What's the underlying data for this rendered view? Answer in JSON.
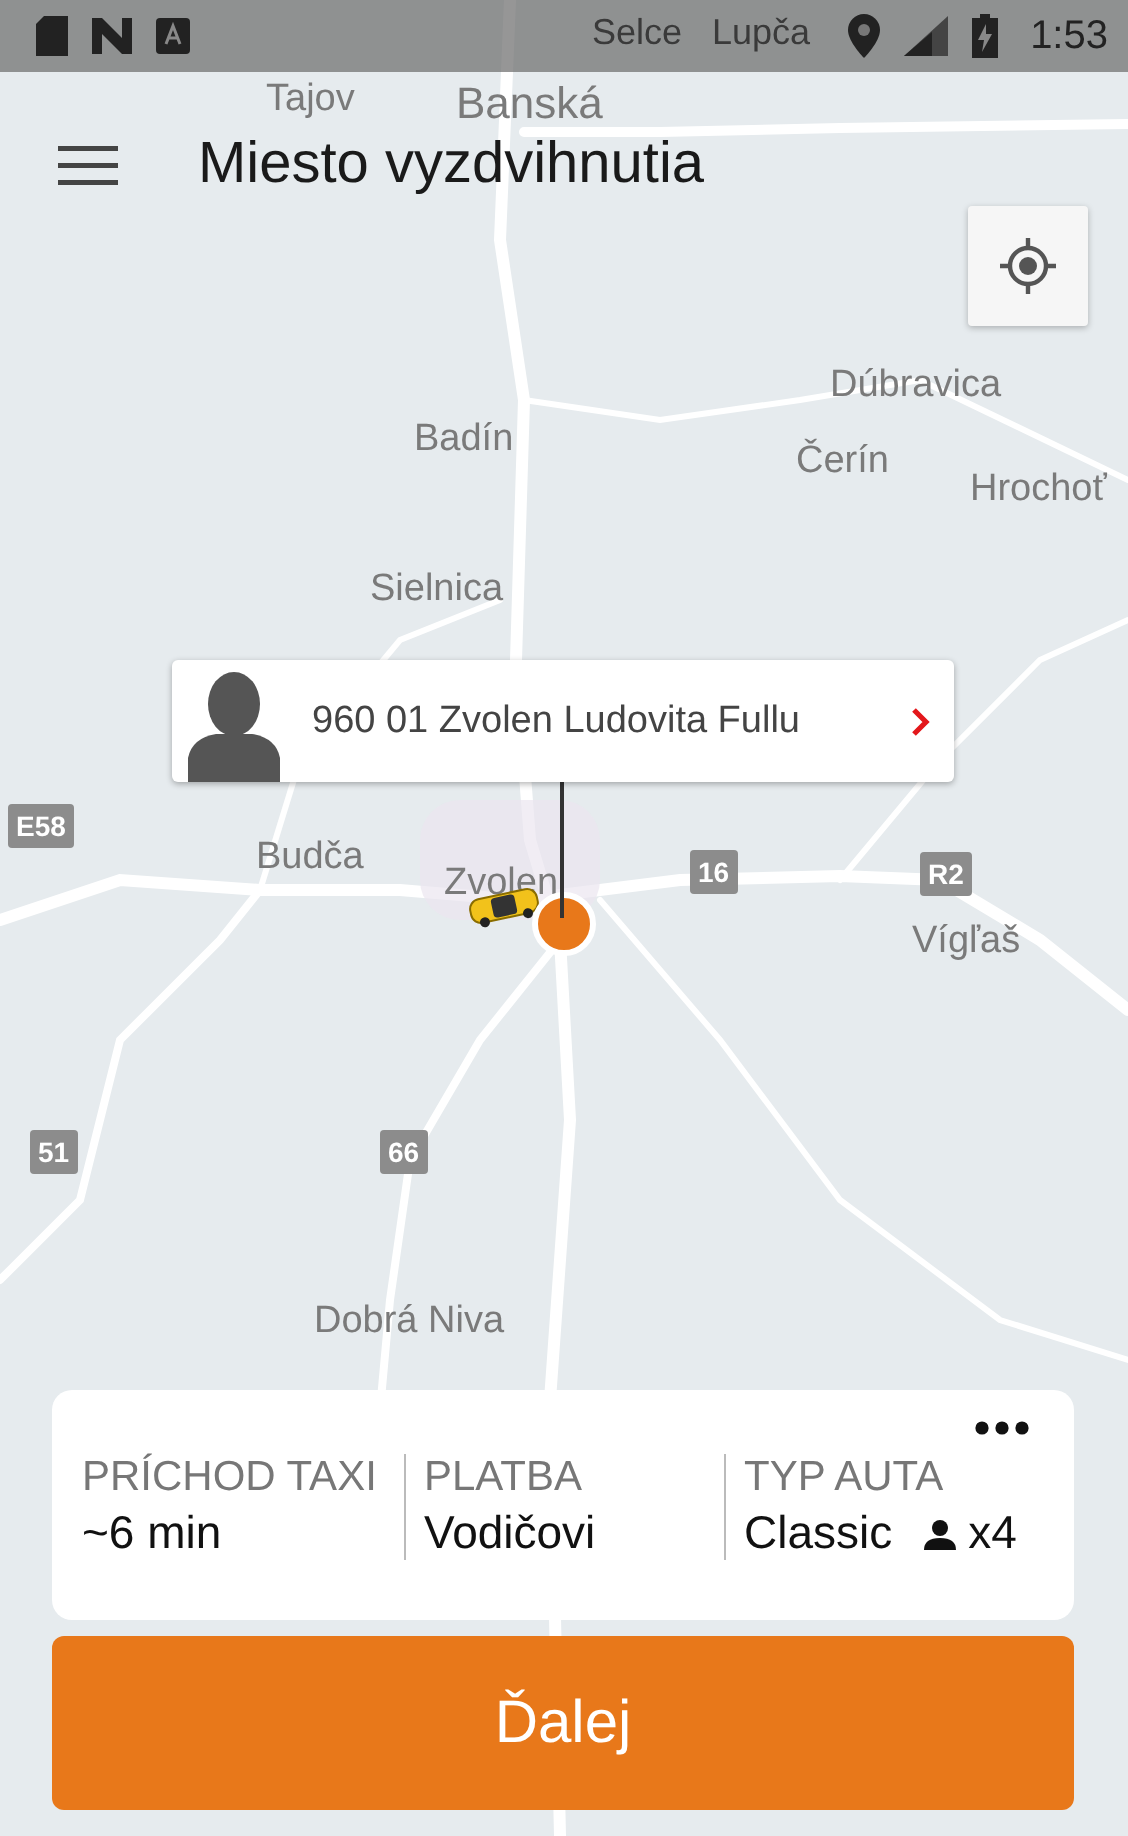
{
  "status_bar": {
    "time": "1:53"
  },
  "header": {
    "title": "Miesto vyzdvihnutia"
  },
  "map": {
    "places": [
      "Selce",
      "Lupča",
      "Tajov",
      "Banská",
      "Dúbravica",
      "Badín",
      "Čerín",
      "Hrochoť",
      "Sielnica",
      "Budča",
      "Zvolen",
      "Vígľaš",
      "Dobrá Niva"
    ],
    "roads": [
      "E58",
      "16",
      "R2",
      "51",
      "66"
    ]
  },
  "pickup": {
    "address": "960 01 Zvolen Ludovita Fullu"
  },
  "summary": {
    "columns": [
      {
        "label": "PRÍCHOD TAXI",
        "value": "~6 min"
      },
      {
        "label": "PLATBA",
        "value": "Vodičovi"
      },
      {
        "label": "TYP AUTA",
        "value": "Classic",
        "seats": "x4"
      }
    ]
  },
  "next_button": {
    "label": "Ďalej"
  }
}
